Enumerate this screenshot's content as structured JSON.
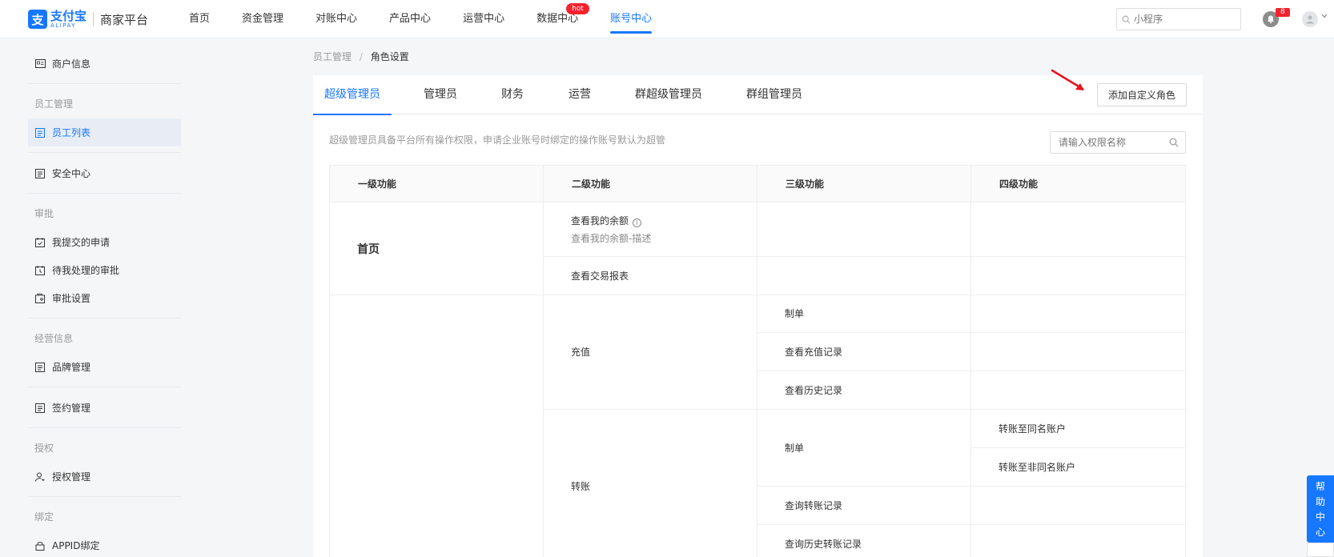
{
  "header": {
    "logo_mark": "支",
    "logo_cn": "支付宝",
    "logo_en": "ALIPAY",
    "platform": "商家平台",
    "nav": [
      "首页",
      "资金管理",
      "对账中心",
      "产品中心",
      "运营中心",
      "数据中心",
      "账号中心"
    ],
    "hot_badge": "hot",
    "search_placeholder": "小程序",
    "notification_count": "8"
  },
  "sidebar": {
    "merchant_info": "商户信息",
    "groups": {
      "staff": "员工管理",
      "approval": "审批",
      "business": "经营信息",
      "auth": "授权",
      "bind": "绑定"
    },
    "items": {
      "staff_list": "员工列表",
      "security": "安全中心",
      "my_applications": "我提交的申请",
      "pending_approvals": "待我处理的审批",
      "approval_settings": "审批设置",
      "brand": "品牌管理",
      "contract": "签约管理",
      "auth_mgmt": "授权管理",
      "appid_bind": "APPID绑定"
    }
  },
  "breadcrumb": {
    "parent": "员工管理",
    "separator": "/",
    "current": "角色设置"
  },
  "tabs": [
    "超级管理员",
    "管理员",
    "财务",
    "运营",
    "群超级管理员",
    "群组管理员"
  ],
  "add_role_button": "添加自定义角色",
  "description": "超级管理员具备平台所有操作权限，申请企业账号时绑定的操作账号默认为超管",
  "perm_search_placeholder": "请输入权限名称",
  "table": {
    "headers": [
      "一级功能",
      "二级功能",
      "三级功能",
      "四级功能"
    ],
    "home": {
      "level1": "首页",
      "balance": "查看我的余额",
      "balance_desc": "查看我的余额-描述",
      "trade_report": "查看交易报表"
    },
    "recharge": {
      "level2": "充值",
      "make_order": "制单",
      "records": "查看充值记录",
      "history": "查看历史记录"
    },
    "transfer": {
      "level2": "转账",
      "make_order": "制单",
      "same_name": "转账至同名账户",
      "diff_name": "转账至非同名账户",
      "records": "查询转账记录",
      "history": "查询历史转账记录"
    }
  },
  "help_center": [
    "帮",
    "助",
    "中",
    "心"
  ],
  "colors": {
    "brand": "#1677ff",
    "badge": "#f5222d",
    "arrow": "#e8141e"
  }
}
